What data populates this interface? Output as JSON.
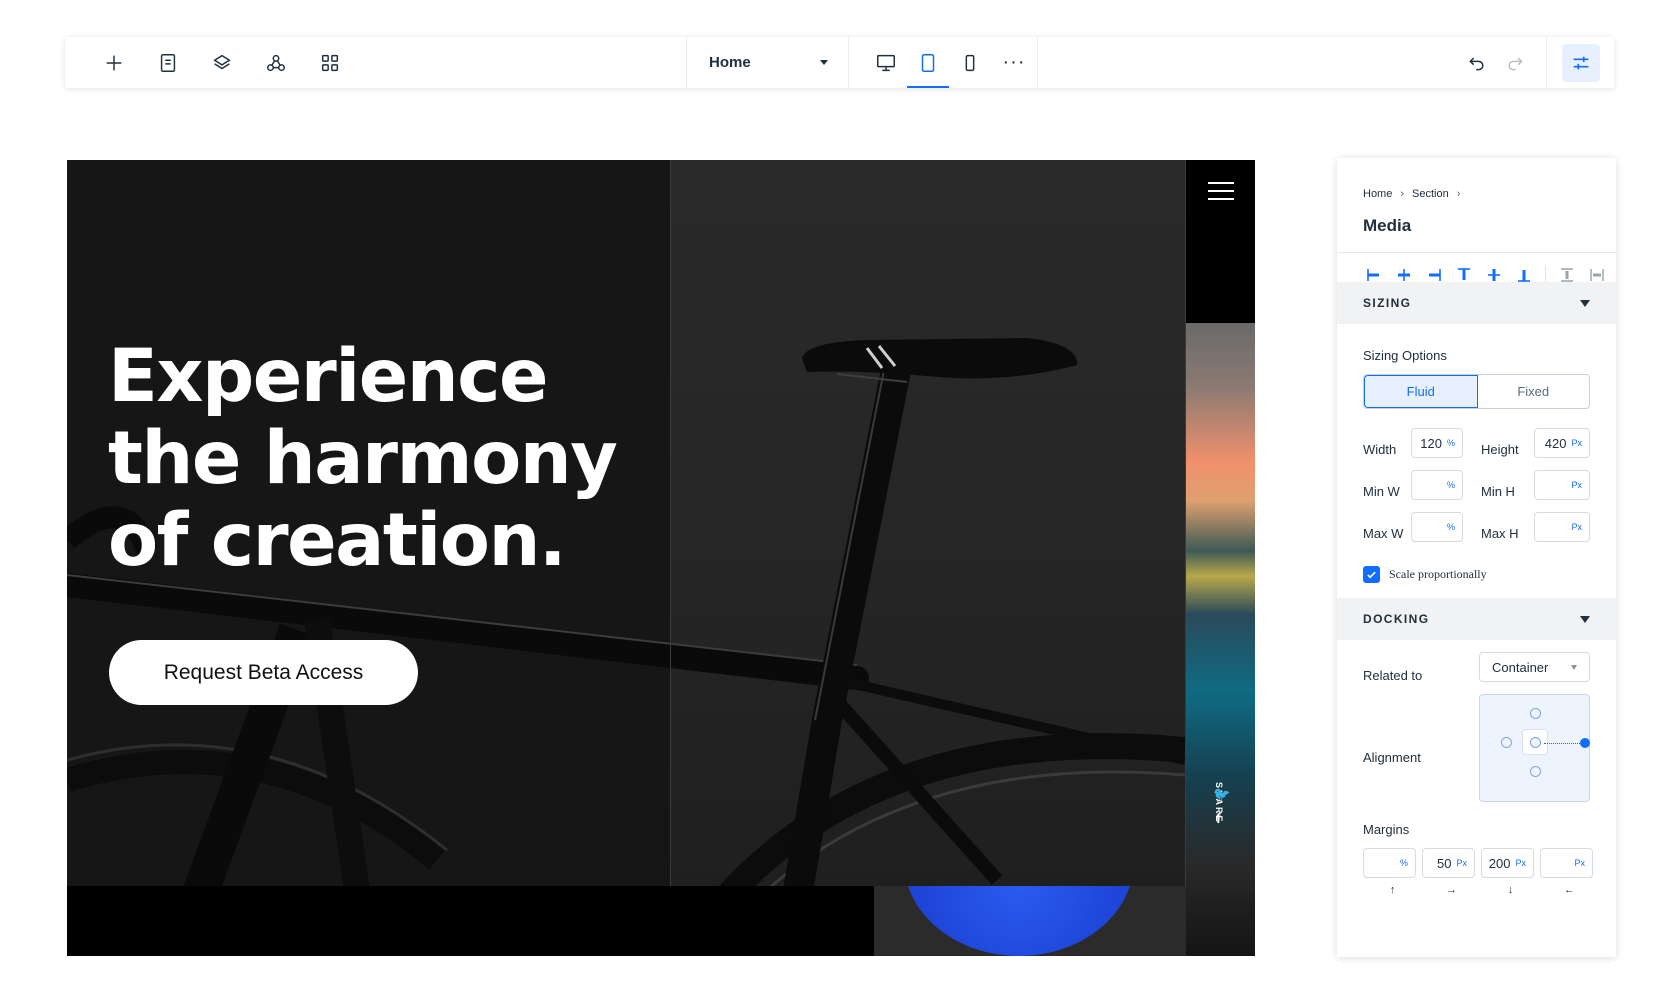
{
  "toolbar": {
    "icons": [
      "add-icon",
      "pages-icon",
      "layers-icon",
      "components-icon",
      "apps-grid-icon"
    ],
    "page_selector": "Home",
    "devices": [
      "desktop-icon",
      "tablet-icon",
      "mobile-icon"
    ],
    "active_device": "tablet",
    "more": "···",
    "accent": "#116dff"
  },
  "canvas": {
    "hero_lines": [
      "Experience",
      "the harmony",
      "of creation."
    ],
    "cta_label": "Request Beta Access",
    "share_label": "SHARE",
    "social": [
      "twitter-icon",
      "facebook-icon"
    ],
    "social_glyphs": [
      "🐦",
      "f"
    ]
  },
  "panel": {
    "breadcrumb": [
      "Home",
      "Section"
    ],
    "title": "Media",
    "sizing": {
      "header": "SIZING",
      "options_label": "Sizing Options",
      "modes": [
        "Fluid",
        "Fixed"
      ],
      "selected_mode": "Fluid",
      "width_label": "Width",
      "width_value": "120",
      "width_unit": "%",
      "height_label": "Height",
      "height_value": "420",
      "height_unit": "Px",
      "minw_label": "Min W",
      "minw_unit": "%",
      "minh_label": "Min H",
      "minh_unit": "Px",
      "maxw_label": "Max W",
      "maxw_unit": "%",
      "maxh_label": "Max H",
      "maxh_unit": "Px",
      "scale_label": "Scale proportionally",
      "scale_checked": true
    },
    "docking": {
      "header": "DOCKING",
      "related_label": "Related to",
      "related_value": "Container",
      "alignment_label": "Alignment",
      "margins_label": "Margins",
      "margins": [
        {
          "value": "",
          "unit": "%"
        },
        {
          "value": "50",
          "unit": "Px"
        },
        {
          "value": "200",
          "unit": "Px"
        },
        {
          "value": "",
          "unit": "Px"
        }
      ],
      "margin_arrows": [
        "↑",
        "→",
        "↓",
        "←"
      ]
    }
  }
}
